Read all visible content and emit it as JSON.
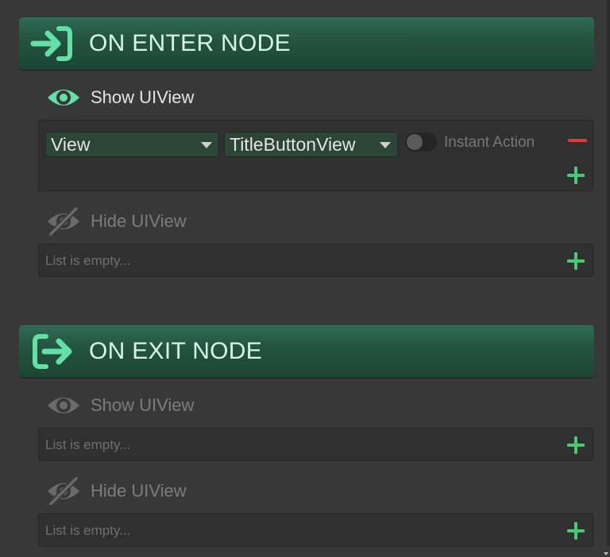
{
  "enter": {
    "title": "ON ENTER NODE",
    "show": {
      "label": "Show UIView",
      "rows": [
        {
          "category": "View",
          "name": "TitleButtonView",
          "toggle_label": "Instant Action",
          "toggle_on": false
        }
      ]
    },
    "hide": {
      "label": "Hide UIView",
      "empty_text": "List is empty..."
    }
  },
  "exit": {
    "title": "ON EXIT NODE",
    "show": {
      "label": "Show UIView",
      "empty_text": "List is empty..."
    },
    "hide": {
      "label": "Hide UIView",
      "empty_text": "List is empty..."
    }
  },
  "colors": {
    "accent": "#62e0a6",
    "add": "#49c974",
    "remove": "#d83b3b",
    "header_bg": "#23533f"
  },
  "icons": {
    "enter": "enter-arrow-icon",
    "exit": "exit-arrow-icon",
    "show": "eye-icon",
    "hide": "eye-slash-icon",
    "add": "plus-icon",
    "remove": "minus-icon",
    "dropdown": "chevron-down-icon"
  }
}
